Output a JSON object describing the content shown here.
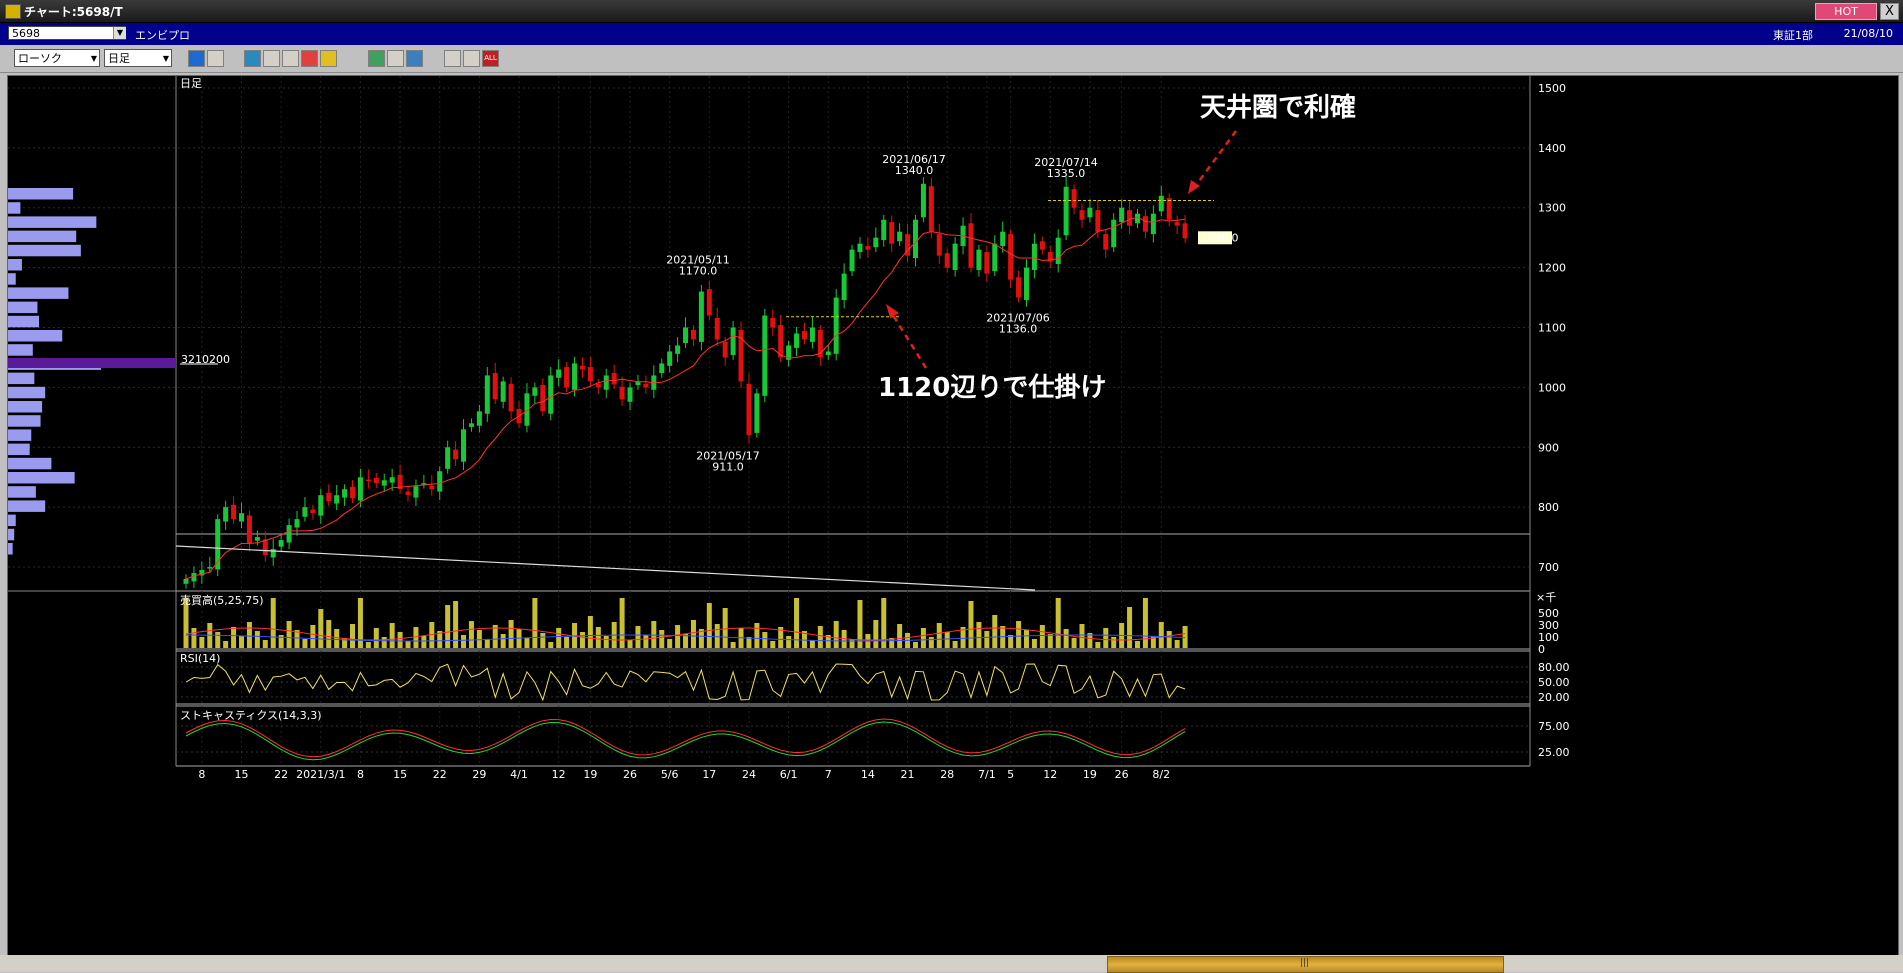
{
  "window": {
    "title": "チャート:5698/T",
    "hot_label": "HOT",
    "close_label": "X"
  },
  "codebar": {
    "code": "5698",
    "name": "エンビプロ",
    "market": "東証1部",
    "date": "21/08/10"
  },
  "toolbar": {
    "chart_type": "ローソク",
    "period": "日足"
  },
  "chart": {
    "period_label": "日足",
    "volume_profile_label": "3210200",
    "price_ticks": [
      "1500",
      "1400",
      "1300",
      "1200",
      "1100",
      "1000",
      "900",
      "800",
      "700"
    ],
    "last_price": "1249.0",
    "annotations": {
      "top": "天井圏で利確",
      "bottom": "1120辺りで仕掛け"
    },
    "peaks": [
      {
        "date": "2021/05/11",
        "value": "1170.0"
      },
      {
        "date": "2021/05/17",
        "value": "911.0"
      },
      {
        "date": "2021/06/17",
        "value": "1340.0"
      },
      {
        "date": "2021/07/14",
        "value": "1335.0"
      },
      {
        "date": "2021/07/06",
        "value": "1136.0"
      }
    ],
    "volume_label": "売買高(5,25,75)",
    "volume_unit": "×千",
    "volume_ticks": [
      "500",
      "300",
      "100",
      "0"
    ],
    "rsi_label": "RSI(14)",
    "rsi_ticks": [
      "80.00",
      "50.00",
      "20.00"
    ],
    "stoch_label": "ストキャスティクス(14,3,3)",
    "stoch_ticks": [
      "75.00",
      "25.00"
    ],
    "x_ticks": [
      "8",
      "15",
      "22",
      "2021/3/1",
      "8",
      "15",
      "22",
      "29",
      "4/1",
      "12",
      "19",
      "26",
      "5/6",
      "17",
      "24",
      "6/1",
      "7",
      "14",
      "21",
      "28",
      "7/1",
      "5",
      "12",
      "19",
      "26",
      "8/2"
    ]
  },
  "colors": {
    "up": "#19c837",
    "down": "#e01010",
    "ma": "#ff3030",
    "volume": "#c8c030",
    "profile": "#9a9aee"
  },
  "chart_data": {
    "type": "candlestick",
    "title": "",
    "ylim": [
      660,
      1520
    ],
    "closes": [
      680,
      690,
      695,
      700,
      780,
      800,
      780,
      790,
      740,
      750,
      720,
      730,
      745,
      770,
      780,
      800,
      790,
      820,
      810,
      820,
      830,
      815,
      850,
      845,
      840,
      845,
      850,
      830,
      820,
      835,
      840,
      830,
      860,
      900,
      880,
      930,
      940,
      960,
      1020,
      980,
      1010,
      960,
      940,
      990,
      1000,
      960,
      1020,
      1030,
      1000,
      1040,
      1030,
      1010,
      1000,
      1020,
      1005,
      980,
      1000,
      1010,
      1000,
      1020,
      1040,
      1060,
      1070,
      1100,
      1080,
      1160,
      1120,
      1080,
      1050,
      1100,
      1010,
      920,
      990,
      1120,
      1100,
      1050,
      1070,
      1090,
      1080,
      1100,
      1050,
      1060,
      1150,
      1190,
      1230,
      1240,
      1230,
      1250,
      1280,
      1240,
      1260,
      1220,
      1280,
      1340,
      1260,
      1220,
      1200,
      1240,
      1270,
      1200,
      1230,
      1190,
      1240,
      1260,
      1180,
      1150,
      1200,
      1240,
      1230,
      1210,
      1250,
      1335,
      1300,
      1280,
      1300,
      1260,
      1230,
      1280,
      1300,
      1270,
      1290,
      1260,
      1290,
      1320,
      1280,
      1270,
      1249
    ],
    "volume_profile": [
      210,
      40,
      285,
      220,
      235,
      45,
      25,
      195,
      95,
      100,
      175,
      80,
      300,
      85,
      120,
      110,
      105,
      75,
      70,
      140,
      215,
      90,
      120,
      25,
      20,
      15
    ]
  }
}
